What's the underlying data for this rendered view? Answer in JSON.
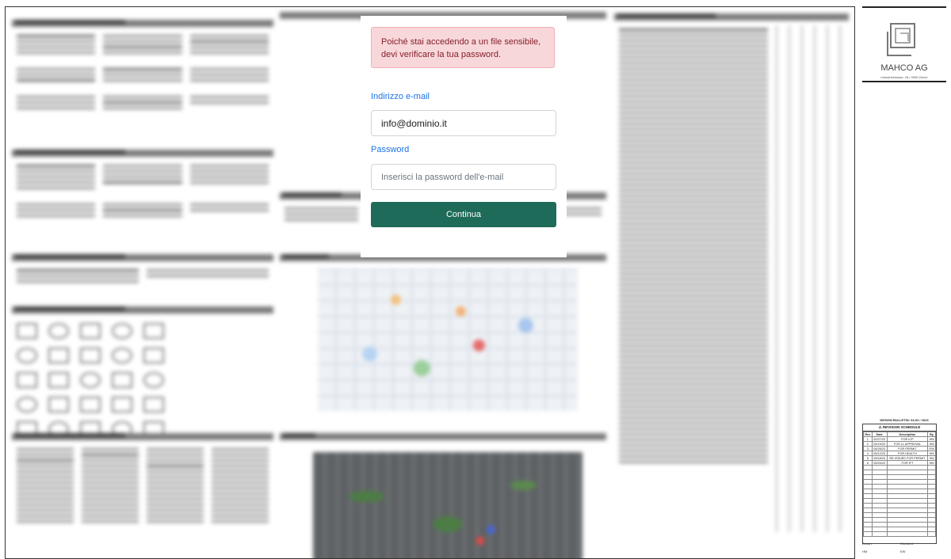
{
  "login": {
    "alert": "Poiché stai accedendo a un file sensibile, devi verificare la tua password.",
    "email_label": "Indirizzo e-mail",
    "email_value": "info@dominio.it",
    "password_label": "Password",
    "password_placeholder": "Inserisci la password dell'e-mail",
    "submit_label": "Continua"
  },
  "title_block": {
    "company": "MAHCO AG",
    "address": "Industriestrasse, 28 | 9999 Zürich",
    "bulletin": "DESIGN BULLETIN: 04-02 / 2023",
    "revision_title": "REVISION SCHEDULE",
    "revision_headers": [
      "Rev",
      "Date",
      "Description",
      "By"
    ],
    "revisions": [
      [
        "1",
        "02/27/23",
        "FOR ICP",
        "HM"
      ],
      [
        "2",
        "04/19/23",
        "FOR LL APPROVAL",
        "HM"
      ],
      [
        "3",
        "04/28/23",
        "FOR PERMIT",
        "EW"
      ],
      [
        "4",
        "05/12/23",
        "FOR HEALTH",
        "HM"
      ],
      [
        "5",
        "05/18/23",
        "RE-ISSUED FOR PERMIT",
        "HM"
      ],
      [
        "6",
        "05/25/23",
        "FOR IFT",
        "HM"
      ]
    ],
    "drawn_label": "Drawn:",
    "checked_label": "Checked:",
    "drawn_by": "HM",
    "checked_by": "EW"
  },
  "colors": {
    "accent": "#1f6b59",
    "link": "#1a73e8",
    "alert_bg": "#f8d7da",
    "alert_text": "#842029"
  },
  "icons": {
    "logo": "company-logo-icon",
    "warning": "warning-triangle-icon"
  }
}
